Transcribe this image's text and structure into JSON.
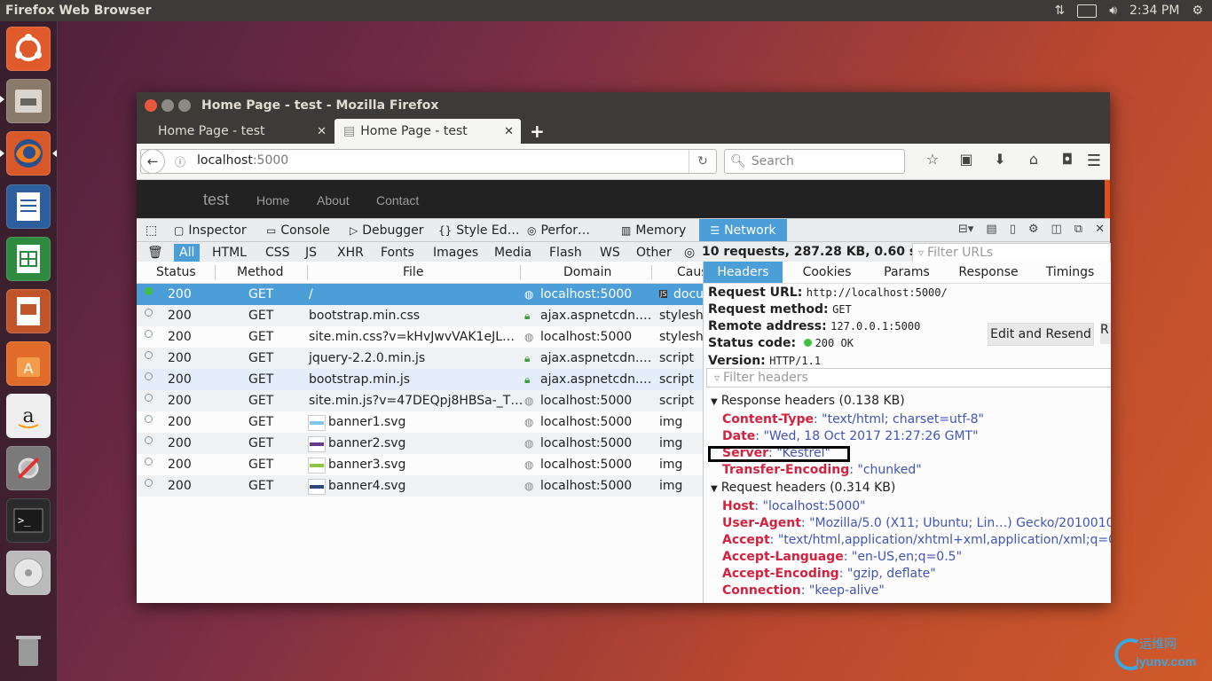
{
  "system": {
    "app_title": "Firefox Web Browser",
    "clock": "2:34 PM"
  },
  "window": {
    "title": "Home Page - test - Mozilla Firefox",
    "tabs": [
      {
        "label": "Home Page - test"
      },
      {
        "label": "Home Page - test"
      }
    ]
  },
  "navbar": {
    "url_host": "localhost",
    "url_port": ":5000",
    "search_placeholder": "Search"
  },
  "site": {
    "brand": "test",
    "links": [
      "Home",
      "About",
      "Contact"
    ]
  },
  "devtools": {
    "tools": [
      "Inspector",
      "Console",
      "Debugger",
      "Style Ed…",
      "Perfor…",
      "Memory",
      "Network"
    ],
    "filters": [
      "All",
      "HTML",
      "CSS",
      "JS",
      "XHR",
      "Fonts",
      "Images",
      "Media",
      "Flash",
      "WS",
      "Other"
    ],
    "summary": "10 requests, 287.28 KB, 0.60 s",
    "filter_urls_placeholder": "Filter URLs",
    "columns": [
      "Status",
      "Method",
      "File",
      "Domain",
      "Caus"
    ],
    "requests": [
      {
        "status": "200",
        "method": "GET",
        "file": "/",
        "domain": "localhost:5000",
        "cause": "docu",
        "secure": false
      },
      {
        "status": "200",
        "method": "GET",
        "file": "bootstrap.min.css",
        "domain": "ajax.aspnetcdn.…",
        "cause": "stylesh",
        "secure": true
      },
      {
        "status": "200",
        "method": "GET",
        "file": "site.min.css?v=kHvJwvVAK1eJL…",
        "domain": "localhost:5000",
        "cause": "stylesh",
        "secure": false
      },
      {
        "status": "200",
        "method": "GET",
        "file": "jquery-2.2.0.min.js",
        "domain": "ajax.aspnetcdn.…",
        "cause": "script",
        "secure": true
      },
      {
        "status": "200",
        "method": "GET",
        "file": "bootstrap.min.js",
        "domain": "ajax.aspnetcdn.…",
        "cause": "script",
        "secure": true
      },
      {
        "status": "200",
        "method": "GET",
        "file": "site.min.js?v=47DEQpj8HBSa-_T…",
        "domain": "localhost:5000",
        "cause": "script",
        "secure": false
      },
      {
        "status": "200",
        "method": "GET",
        "file": "banner1.svg",
        "domain": "localhost:5000",
        "cause": "img",
        "secure": false
      },
      {
        "status": "200",
        "method": "GET",
        "file": "banner2.svg",
        "domain": "localhost:5000",
        "cause": "img",
        "secure": false
      },
      {
        "status": "200",
        "method": "GET",
        "file": "banner3.svg",
        "domain": "localhost:5000",
        "cause": "img",
        "secure": false
      },
      {
        "status": "200",
        "method": "GET",
        "file": "banner4.svg",
        "domain": "localhost:5000",
        "cause": "img",
        "secure": false
      }
    ],
    "detail_tabs": [
      "Headers",
      "Cookies",
      "Params",
      "Response",
      "Timings"
    ],
    "detail": {
      "request_url_label": "Request URL:",
      "request_url": "http://localhost:5000/",
      "request_method_label": "Request method:",
      "request_method": "GET",
      "remote_address_label": "Remote address:",
      "remote_address": "127.0.0.1:5000",
      "status_code_label": "Status code:",
      "status_code": "200 OK",
      "version_label": "Version:",
      "version": "HTTP/1.1",
      "edit_resend": "Edit and Resend",
      "edit_resend_cut": "R",
      "filter_headers_placeholder": "Filter headers",
      "response_headers_title": "Response headers (0.138 KB)",
      "response_headers": [
        {
          "k": "Content-Type",
          "v": "\"text/html; charset=utf-8\""
        },
        {
          "k": "Date",
          "v": "\"Wed, 18 Oct 2017 21:27:26 GMT\""
        },
        {
          "k": "Server",
          "v": "\"Kestrel\""
        },
        {
          "k": "Transfer-Encoding",
          "v": "\"chunked\""
        }
      ],
      "request_headers_title": "Request headers (0.314 KB)",
      "request_headers": [
        {
          "k": "Host",
          "v": "\"localhost:5000\""
        },
        {
          "k": "User-Agent",
          "v": "\"Mozilla/5.0 (X11; Ubuntu; Lin…) Gecko/20100101 F"
        },
        {
          "k": "Accept",
          "v": "\"text/html,application/xhtml+xml,application/xml;q=0."
        },
        {
          "k": "Accept-Language",
          "v": "\"en-US,en;q=0.5\""
        },
        {
          "k": "Accept-Encoding",
          "v": "\"gzip, deflate\""
        },
        {
          "k": "Connection",
          "v": "\"keep-alive\""
        }
      ]
    }
  },
  "watermark": {
    "cn": "运维网",
    "site": "iyunv.com"
  }
}
